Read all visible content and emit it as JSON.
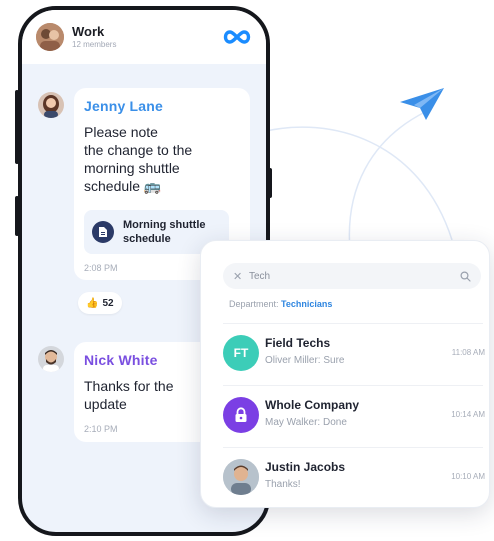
{
  "chat_header": {
    "title": "Work",
    "subtitle": "12 members"
  },
  "messages": [
    {
      "sender": "Jenny Lane",
      "lines": [
        "Please note",
        "the change to the",
        "morning shuttle",
        "schedule 🚌"
      ],
      "attachment": {
        "line1": "Morning shuttle",
        "line2": "schedule"
      },
      "time": "2:08 PM",
      "reaction": {
        "emoji": "👍",
        "count": "52"
      }
    },
    {
      "sender": "Nick White",
      "lines": [
        "Thanks for the",
        "update"
      ],
      "time": "2:10 PM"
    }
  ],
  "search": {
    "query": "Tech",
    "department_label": "Department:",
    "department_value": "Technicians"
  },
  "results": [
    {
      "initials": "FT",
      "name": "Field Techs",
      "preview": "Oliver Miller: Sure",
      "time": "11:08 AM",
      "color": "#3ccdb8"
    },
    {
      "name": "Whole Company",
      "preview": "May Walker: Done",
      "time": "10:14 AM",
      "color": "#7b3fe4"
    },
    {
      "name": "Justin Jacobs",
      "preview": "Thanks!",
      "time": "10:10 AM"
    }
  ],
  "colors": {
    "accent_blue": "#2f86e0",
    "accent_purple": "#7a4fe0",
    "brand_logo": "#1a8cff",
    "plane": "#3a8fe8"
  },
  "icons": {
    "header_logo": "infinity-logo-icon",
    "attachment": "document-icon",
    "search": "search-icon",
    "clear": "close-icon",
    "lock": "lock-icon",
    "plane": "paper-plane-icon"
  }
}
